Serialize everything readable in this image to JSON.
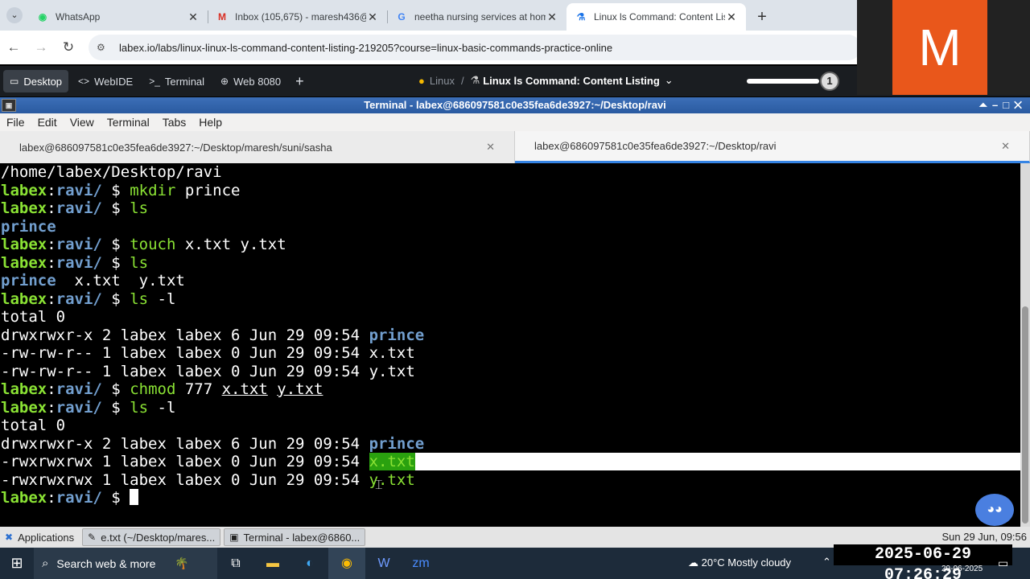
{
  "chrome": {
    "tabs": [
      {
        "label": "WhatsApp",
        "icon": "whatsapp-icon",
        "glyph": "◉",
        "color": "#25d366"
      },
      {
        "label": "Inbox (105,675) - maresh436@...",
        "icon": "gmail-icon",
        "glyph": "M",
        "color": "#d93025"
      },
      {
        "label": "neetha nursing services at hom...",
        "icon": "google-icon",
        "glyph": "G",
        "color": "#4285f4"
      },
      {
        "label": "Linux ls Command: Content List...",
        "icon": "labex-icon",
        "glyph": "⚗",
        "color": "#1a73e8"
      }
    ],
    "url": "labex.io/labs/linux-linux-ls-command-content-listing-219205?course=linux-basic-commands-practice-online"
  },
  "labex": {
    "buttons": [
      {
        "label": "Desktop",
        "icon": "▭"
      },
      {
        "label": "WebIDE",
        "icon": "<>"
      },
      {
        "label": "Terminal",
        "icon": ">_"
      },
      {
        "label": "Web 8080",
        "icon": "⊕"
      }
    ],
    "breadcrumb_root": "Linux",
    "breadcrumb_title": "Linux ls Command: Content Listing",
    "step_number": "1"
  },
  "meeting": {
    "initial": "M"
  },
  "terminal": {
    "window_title": "Terminal - labex@686097581c0e35fea6de3927:~/Desktop/ravi",
    "menu": [
      "File",
      "Edit",
      "View",
      "Terminal",
      "Tabs",
      "Help"
    ],
    "tabs": [
      "labex@686097581c0e35fea6de3927:~/Desktop/maresh/suni/sasha",
      "labex@686097581c0e35fea6de3927:~/Desktop/ravi"
    ],
    "user": "labex",
    "cwd": "ravi/",
    "prompt_sign": " $ ",
    "output": {
      "path": "/home/labex/Desktop/ravi",
      "total": "total 0",
      "dir_name": "prince",
      "files": [
        "x.txt",
        "y.txt"
      ],
      "ls_gap": "  ",
      "perm_dir": "drwxrwxr-x 2 labex labex 6 Jun 29 09:54 ",
      "perm_file": "-rw-rw-r-- 1 labex labex 0 Jun 29 09:54 ",
      "perm_exec": "-rwxrwxrwx 1 labex labex 0 Jun 29 09:54 "
    },
    "commands": {
      "mkdir": "mkdir",
      "mkdir_arg": " prince",
      "ls": "ls",
      "ls_l_arg": " -l",
      "touch": "touch",
      "touch_args": " x.txt y.txt",
      "chmod": "chmod",
      "chmod_mode": " 777 "
    }
  },
  "xfce": {
    "applications": "Applications",
    "win1": "e.txt (~/Desktop/mares...",
    "win2": "Terminal - labex@6860...",
    "clock": "Sun 29 Jun, 09:56"
  },
  "taskbar": {
    "search": "Search web & more",
    "weather": "20°C  Mostly cloudy",
    "overlay_datetime": "2025-06-29 07:26:29",
    "date": "29-06-2025"
  }
}
